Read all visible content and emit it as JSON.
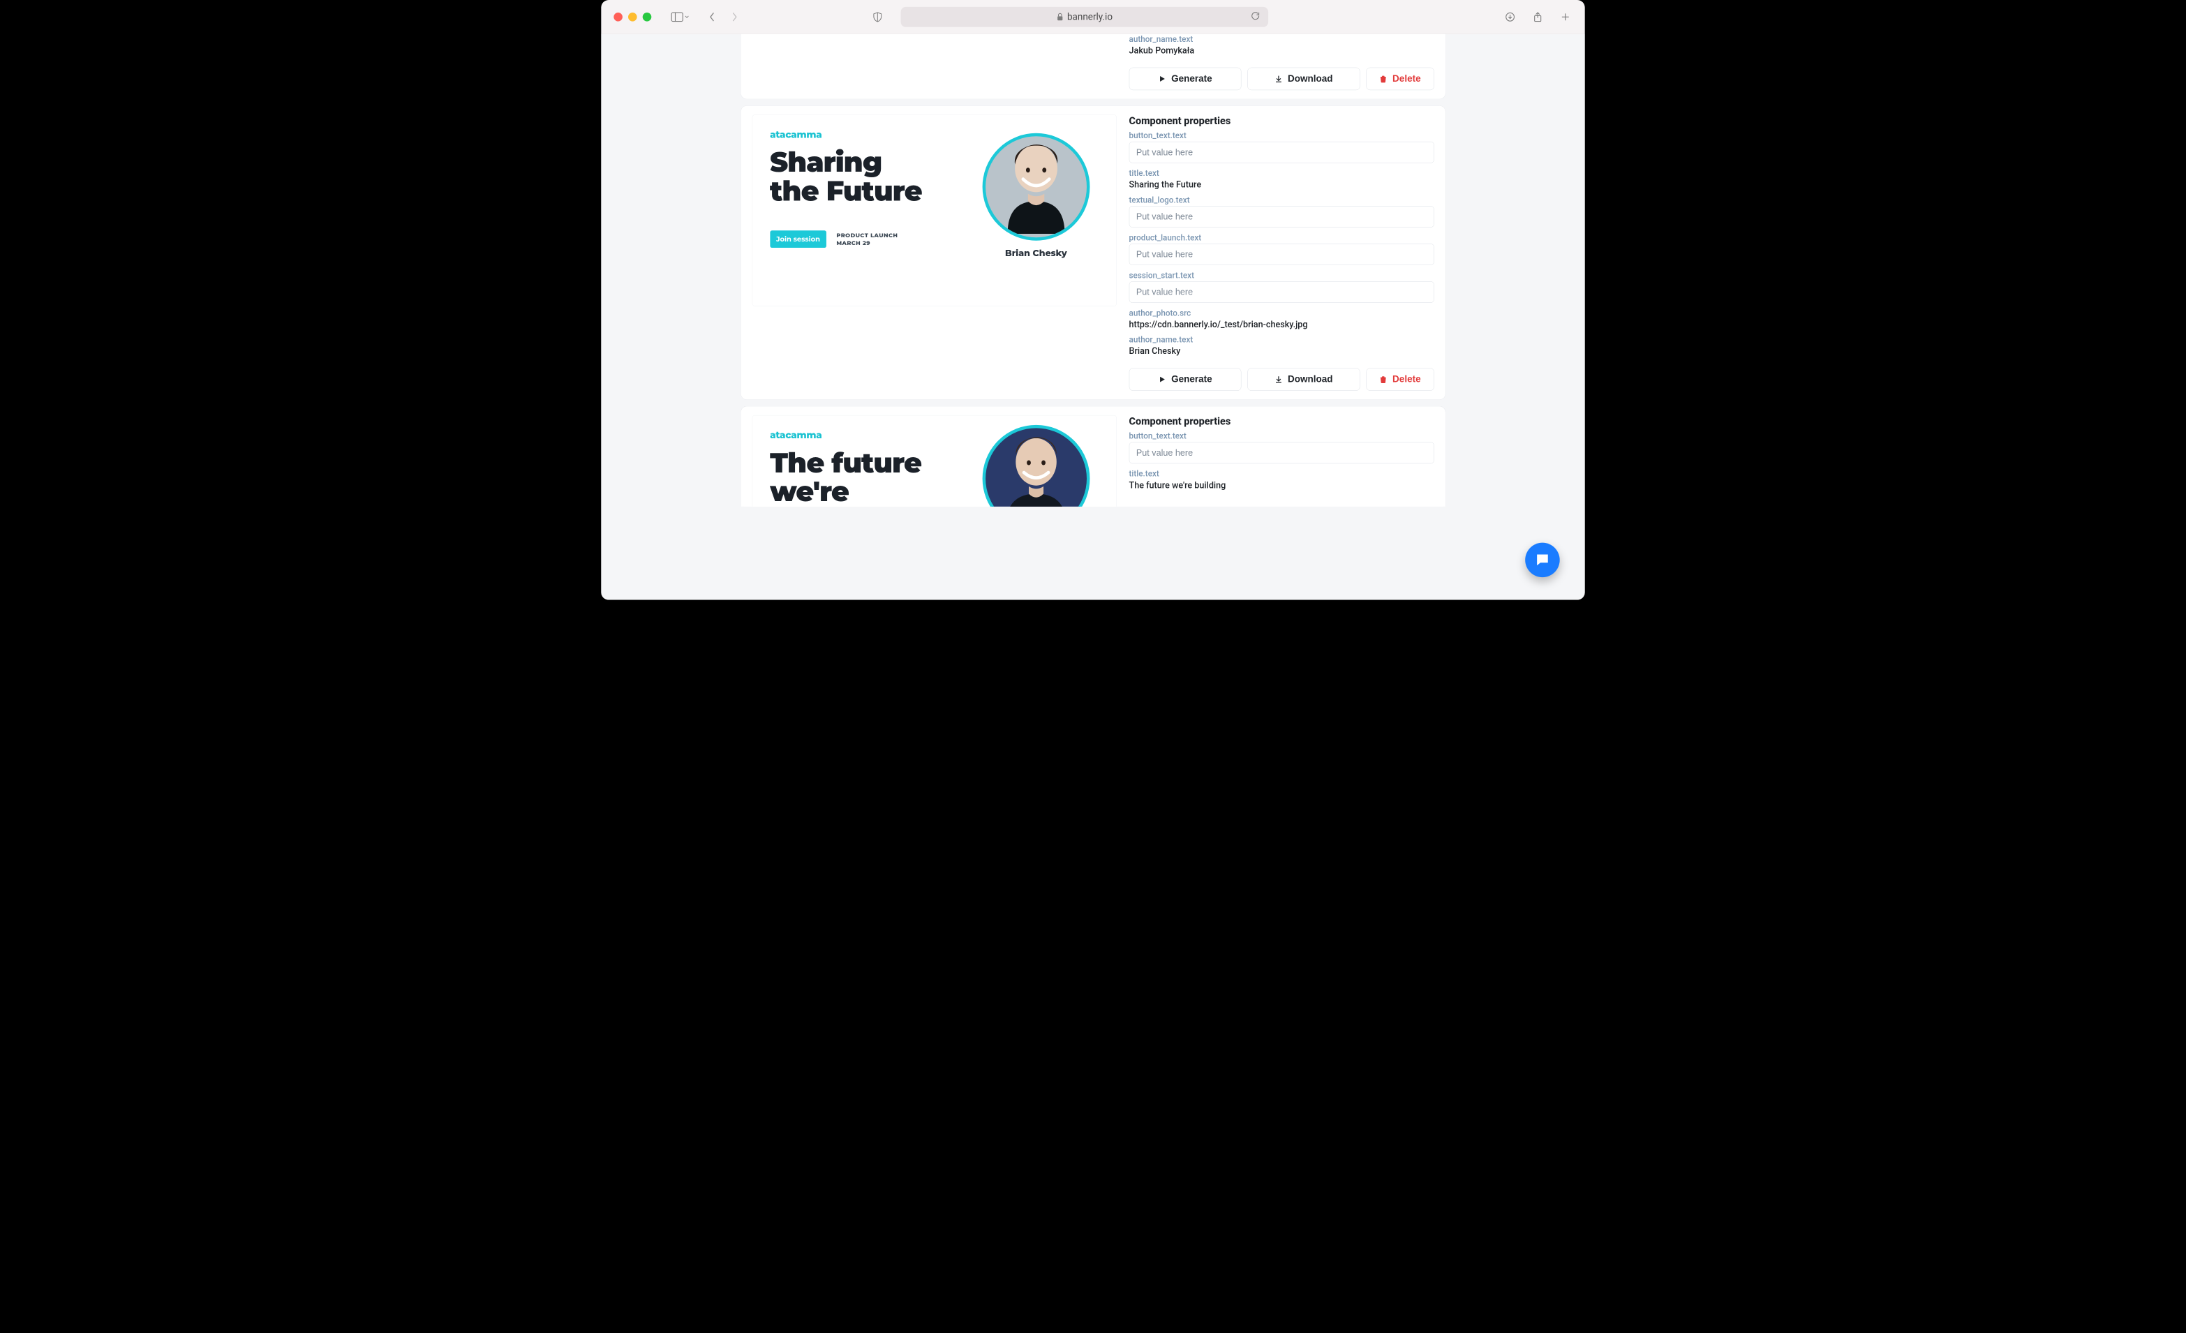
{
  "browser": {
    "host": "bannerly.io"
  },
  "common": {
    "properties_title": "Component properties",
    "placeholder": "Put value here",
    "generate": "Generate",
    "download": "Download",
    "delete": "Delete"
  },
  "cards": [
    {
      "props": {
        "author_name_label": "author_name.text",
        "author_name_value": "Jakub Pomykała"
      }
    },
    {
      "banner": {
        "logo": "atacamma",
        "title_line1": "Sharing",
        "title_line2": "the Future",
        "cta": "Join session",
        "meta_line1": "PRODUCT LAUNCH",
        "meta_line2": "MARCH 29",
        "person_name": "Brian Chesky"
      },
      "props": {
        "button_text_label": "button_text.text",
        "title_label": "title.text",
        "title_value": "Sharing the Future",
        "textual_logo_label": "textual_logo.text",
        "product_launch_label": "product_launch.text",
        "session_start_label": "session_start.text",
        "author_photo_label": "author_photo.src",
        "author_photo_value": "https://cdn.bannerly.io/_test/brian-chesky.jpg",
        "author_name_label": "author_name.text",
        "author_name_value": "Brian Chesky"
      }
    },
    {
      "banner": {
        "logo": "atacamma",
        "title_line1": "The future",
        "title_line2": "we're"
      },
      "props": {
        "button_text_label": "button_text.text",
        "title_label": "title.text",
        "title_value": "The future we're building"
      }
    }
  ]
}
